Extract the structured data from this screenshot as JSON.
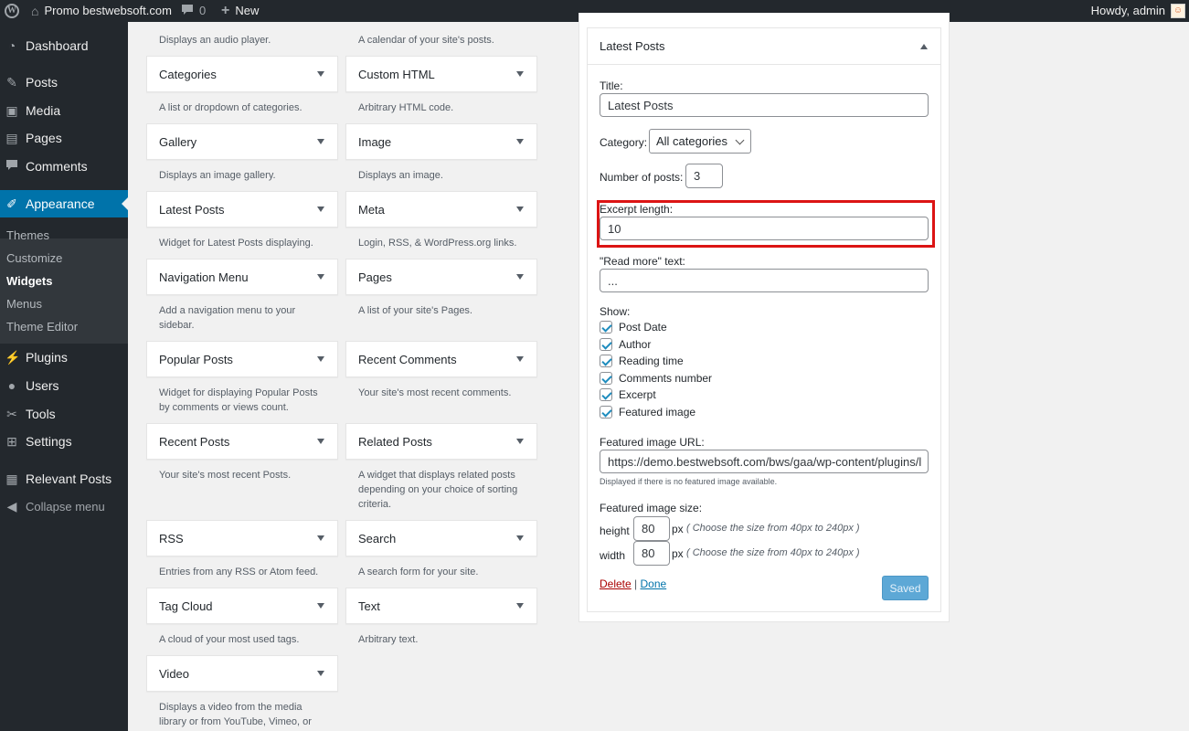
{
  "adminbar": {
    "site_name": "Promo bestwebsoft.com",
    "comments_count": "0",
    "new_label": "New",
    "howdy": "Howdy, admin"
  },
  "sidebar": {
    "items": [
      {
        "label": "Dashboard",
        "icon": "dashboard-icon"
      },
      {
        "label": "Posts",
        "icon": "pin-icon"
      },
      {
        "label": "Media",
        "icon": "media-icon"
      },
      {
        "label": "Pages",
        "icon": "pages-icon"
      },
      {
        "label": "Comments",
        "icon": "comments-icon"
      },
      {
        "label": "Appearance",
        "icon": "brush-icon"
      },
      {
        "label": "Plugins",
        "icon": "plugin-icon"
      },
      {
        "label": "Users",
        "icon": "users-icon"
      },
      {
        "label": "Tools",
        "icon": "wrench-icon"
      },
      {
        "label": "Settings",
        "icon": "settings-icon"
      },
      {
        "label": "Relevant Posts",
        "icon": "relevant-posts-icon"
      }
    ],
    "submenu": [
      "Themes",
      "Customize",
      "Widgets",
      "Menus",
      "Theme Editor"
    ],
    "collapse": "Collapse menu"
  },
  "widgets": {
    "top_descs": [
      "Displays an audio player.",
      "A calendar of your site's posts."
    ],
    "rows": [
      [
        {
          "title": "Categories",
          "desc": "A list or dropdown of categories."
        },
        {
          "title": "Custom HTML",
          "desc": "Arbitrary HTML code."
        }
      ],
      [
        {
          "title": "Gallery",
          "desc": "Displays an image gallery."
        },
        {
          "title": "Image",
          "desc": "Displays an image."
        }
      ],
      [
        {
          "title": "Latest Posts",
          "desc": "Widget for Latest Posts displaying."
        },
        {
          "title": "Meta",
          "desc": "Login, RSS, & WordPress.org links."
        }
      ],
      [
        {
          "title": "Navigation Menu",
          "desc": "Add a navigation menu to your sidebar."
        },
        {
          "title": "Pages",
          "desc": "A list of your site's Pages."
        }
      ],
      [
        {
          "title": "Popular Posts",
          "desc": "Widget for displaying Popular Posts by comments or views count."
        },
        {
          "title": "Recent Comments",
          "desc": "Your site's most recent comments."
        }
      ],
      [
        {
          "title": "Recent Posts",
          "desc": "Your site's most recent Posts."
        },
        {
          "title": "Related Posts",
          "desc": "A widget that displays related posts depending on your choice of sorting criteria."
        }
      ],
      [
        {
          "title": "RSS",
          "desc": "Entries from any RSS or Atom feed."
        },
        {
          "title": "Search",
          "desc": "A search form for your site."
        }
      ],
      [
        {
          "title": "Tag Cloud",
          "desc": "A cloud of your most used tags."
        },
        {
          "title": "Text",
          "desc": "Arbitrary text."
        }
      ],
      [
        {
          "title": "Video",
          "desc": "Displays a video from the media library or from YouTube, Vimeo, or"
        }
      ]
    ]
  },
  "panel": {
    "header": "Latest Posts",
    "title_label": "Title:",
    "title_value": "Latest Posts",
    "category_label": "Category:",
    "category_value": "All categories",
    "number_label": "Number of posts:",
    "number_value": "3",
    "excerpt_label": "Excerpt length:",
    "excerpt_value": "10",
    "readmore_label": "\"Read more\" text:",
    "readmore_value": "...",
    "show_label": "Show:",
    "show_options": [
      "Post Date",
      "Author",
      "Reading time",
      "Comments number",
      "Excerpt",
      "Featured image"
    ],
    "featured_url_label": "Featured image URL:",
    "featured_url_value": "https://demo.bestwebsoft.com/bws/gaa/wp-content/plugins/l",
    "featured_note": "Displayed if there is no featured image available.",
    "featured_size_label": "Featured image size:",
    "height_label": "height",
    "height_value": "80",
    "width_label": "width",
    "width_value": "80",
    "px": "px",
    "size_hint": "( Choose the size from 40px to 240px )",
    "delete_label": "Delete",
    "separator": "|",
    "done_label": "Done",
    "saved_label": "Saved"
  },
  "colors": {
    "sidebar_bg": "#23282d",
    "accent": "#0073aa",
    "highlight_border": "#dc1414"
  }
}
